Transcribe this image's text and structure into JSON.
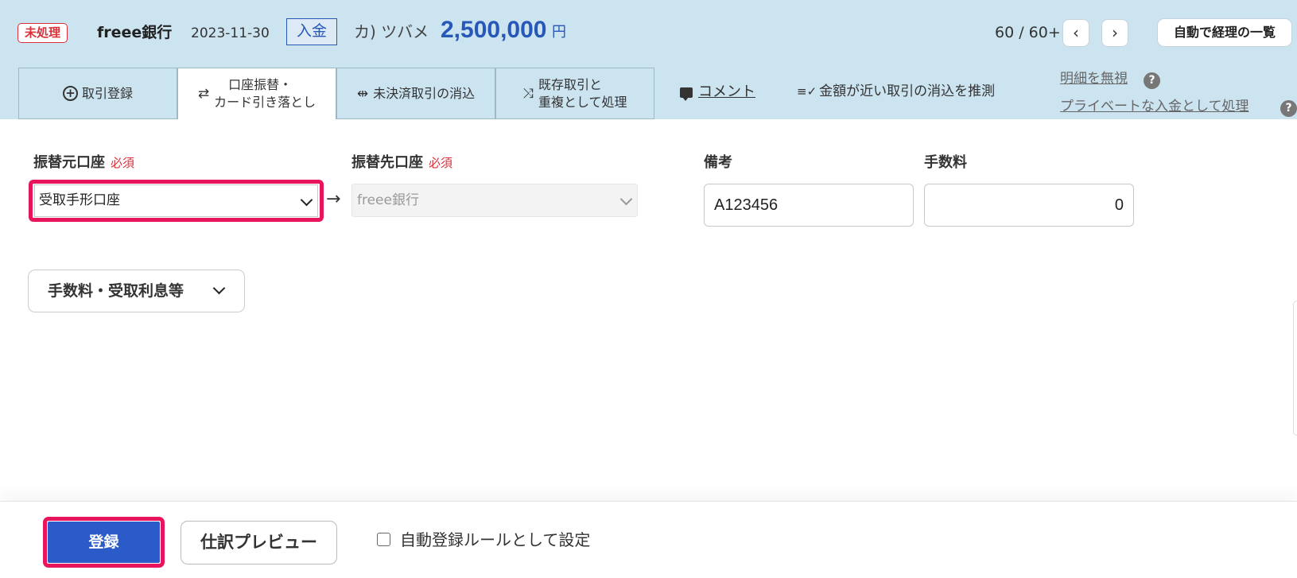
{
  "header": {
    "status": "未処理",
    "bank": "freee銀行",
    "date": "2023-11-30",
    "type": "入金",
    "partner": "カ) ツバメ",
    "amount": "2,500,000",
    "currency": "円",
    "pager": "60 / 60+",
    "prev": "‹",
    "next": "›",
    "list_button": "自動で経理の一覧"
  },
  "tabs": [
    {
      "label": "取引登録"
    },
    {
      "label_line1": "口座振替・",
      "label_line2": "カード引き落とし",
      "icon": "⇄"
    },
    {
      "label": "未決済取引の消込",
      "icon": "⇹"
    },
    {
      "label_line1": "既存取引と",
      "label_line2": "重複として処理",
      "icon": "⤨"
    }
  ],
  "links": {
    "comment": "コメント",
    "guess": "金額が近い取引の消込を推測",
    "ignore": "明細を無視",
    "private": "プライベートな入金として処理",
    "help": "?"
  },
  "form": {
    "from_label": "振替元口座",
    "to_label": "振替先口座",
    "required": "必須",
    "from_value": "受取手形口座",
    "to_value": "freee銀行",
    "arrow": "→",
    "memo_label": "備考",
    "memo_value": "A123456",
    "fee_label": "手数料",
    "fee_value": "0",
    "accordion": "手数料・受取利息等"
  },
  "footer": {
    "submit": "登録",
    "preview": "仕訳プレビュー",
    "auto_rule": "自動登録ルールとして設定"
  },
  "colors": {
    "header_bg": "#cce3f0",
    "accent_blue": "#2758b8",
    "highlight": "#e8145c",
    "status_red": "#d9303a"
  }
}
